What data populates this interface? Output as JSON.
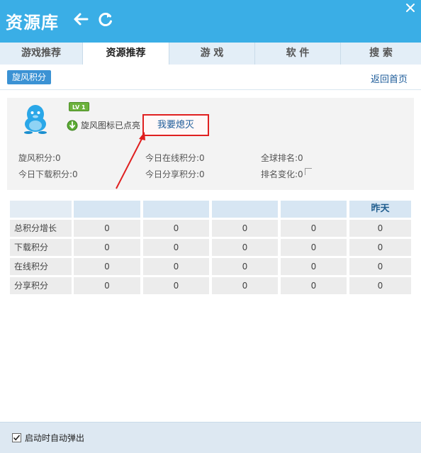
{
  "app": {
    "title": "资源库"
  },
  "tabs": [
    {
      "label": "游戏推荐"
    },
    {
      "label": "资源推荐"
    },
    {
      "label": "游 戏"
    },
    {
      "label": "软 件"
    },
    {
      "label": "搜 索"
    }
  ],
  "toolbar": {
    "chip": "旋风积分",
    "home": "返回首页"
  },
  "profile": {
    "level": "LV 1",
    "status": "旋风图标已点亮",
    "action": "我要熄灭"
  },
  "stats": {
    "points": "旋风积分:0",
    "today_online": "今日在线积分:0",
    "global_rank": "全球排名:0",
    "today_download": "今日下载积分:0",
    "today_share": "今日分享积分:0",
    "rank_change": "排名变化:0"
  },
  "table": {
    "headers": [
      "",
      "",
      "",
      "",
      "",
      "昨天"
    ],
    "rows": [
      {
        "label": "总积分增长",
        "values": [
          "0",
          "0",
          "0",
          "0",
          "0"
        ]
      },
      {
        "label": "下载积分",
        "values": [
          "0",
          "0",
          "0",
          "0",
          "0"
        ]
      },
      {
        "label": "在线积分",
        "values": [
          "0",
          "0",
          "0",
          "0",
          "0"
        ]
      },
      {
        "label": "分享积分",
        "values": [
          "0",
          "0",
          "0",
          "0",
          "0"
        ]
      }
    ]
  },
  "footer": {
    "autostart_label": "启动时自动弹出",
    "autostart_checked": true
  },
  "colors": {
    "titlebar": "#3aaee6",
    "accent": "#3b92d4",
    "highlight": "#e02020"
  }
}
